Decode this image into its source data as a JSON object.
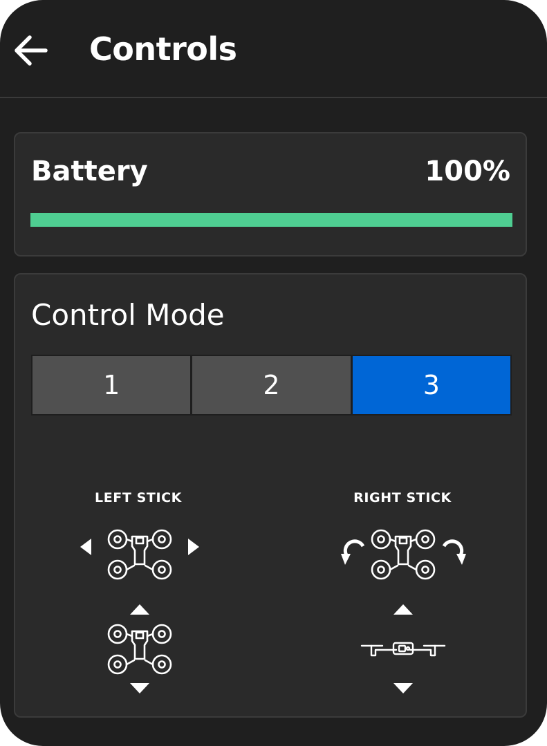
{
  "header": {
    "title": "Controls",
    "back_icon": "arrow-left-icon"
  },
  "battery": {
    "title": "Battery",
    "value": "100%",
    "level_percent": 100,
    "color": "#4fce92"
  },
  "control_mode": {
    "title": "Control Mode",
    "options": [
      "1",
      "2",
      "3"
    ],
    "selected": "3",
    "accent": "#0066d6"
  },
  "sticks": {
    "left": {
      "label": "LEFT STICK",
      "icons": [
        "arrow-left-icon",
        "drone-top-icon",
        "arrow-right-icon",
        "arrow-up-icon",
        "drone-top-icon",
        "arrow-down-icon"
      ]
    },
    "right": {
      "label": "RIGHT STICK",
      "icons": [
        "rotate-ccw-icon",
        "drone-top-icon",
        "rotate-cw-icon",
        "arrow-up-icon",
        "drone-side-icon",
        "arrow-down-icon"
      ]
    }
  }
}
